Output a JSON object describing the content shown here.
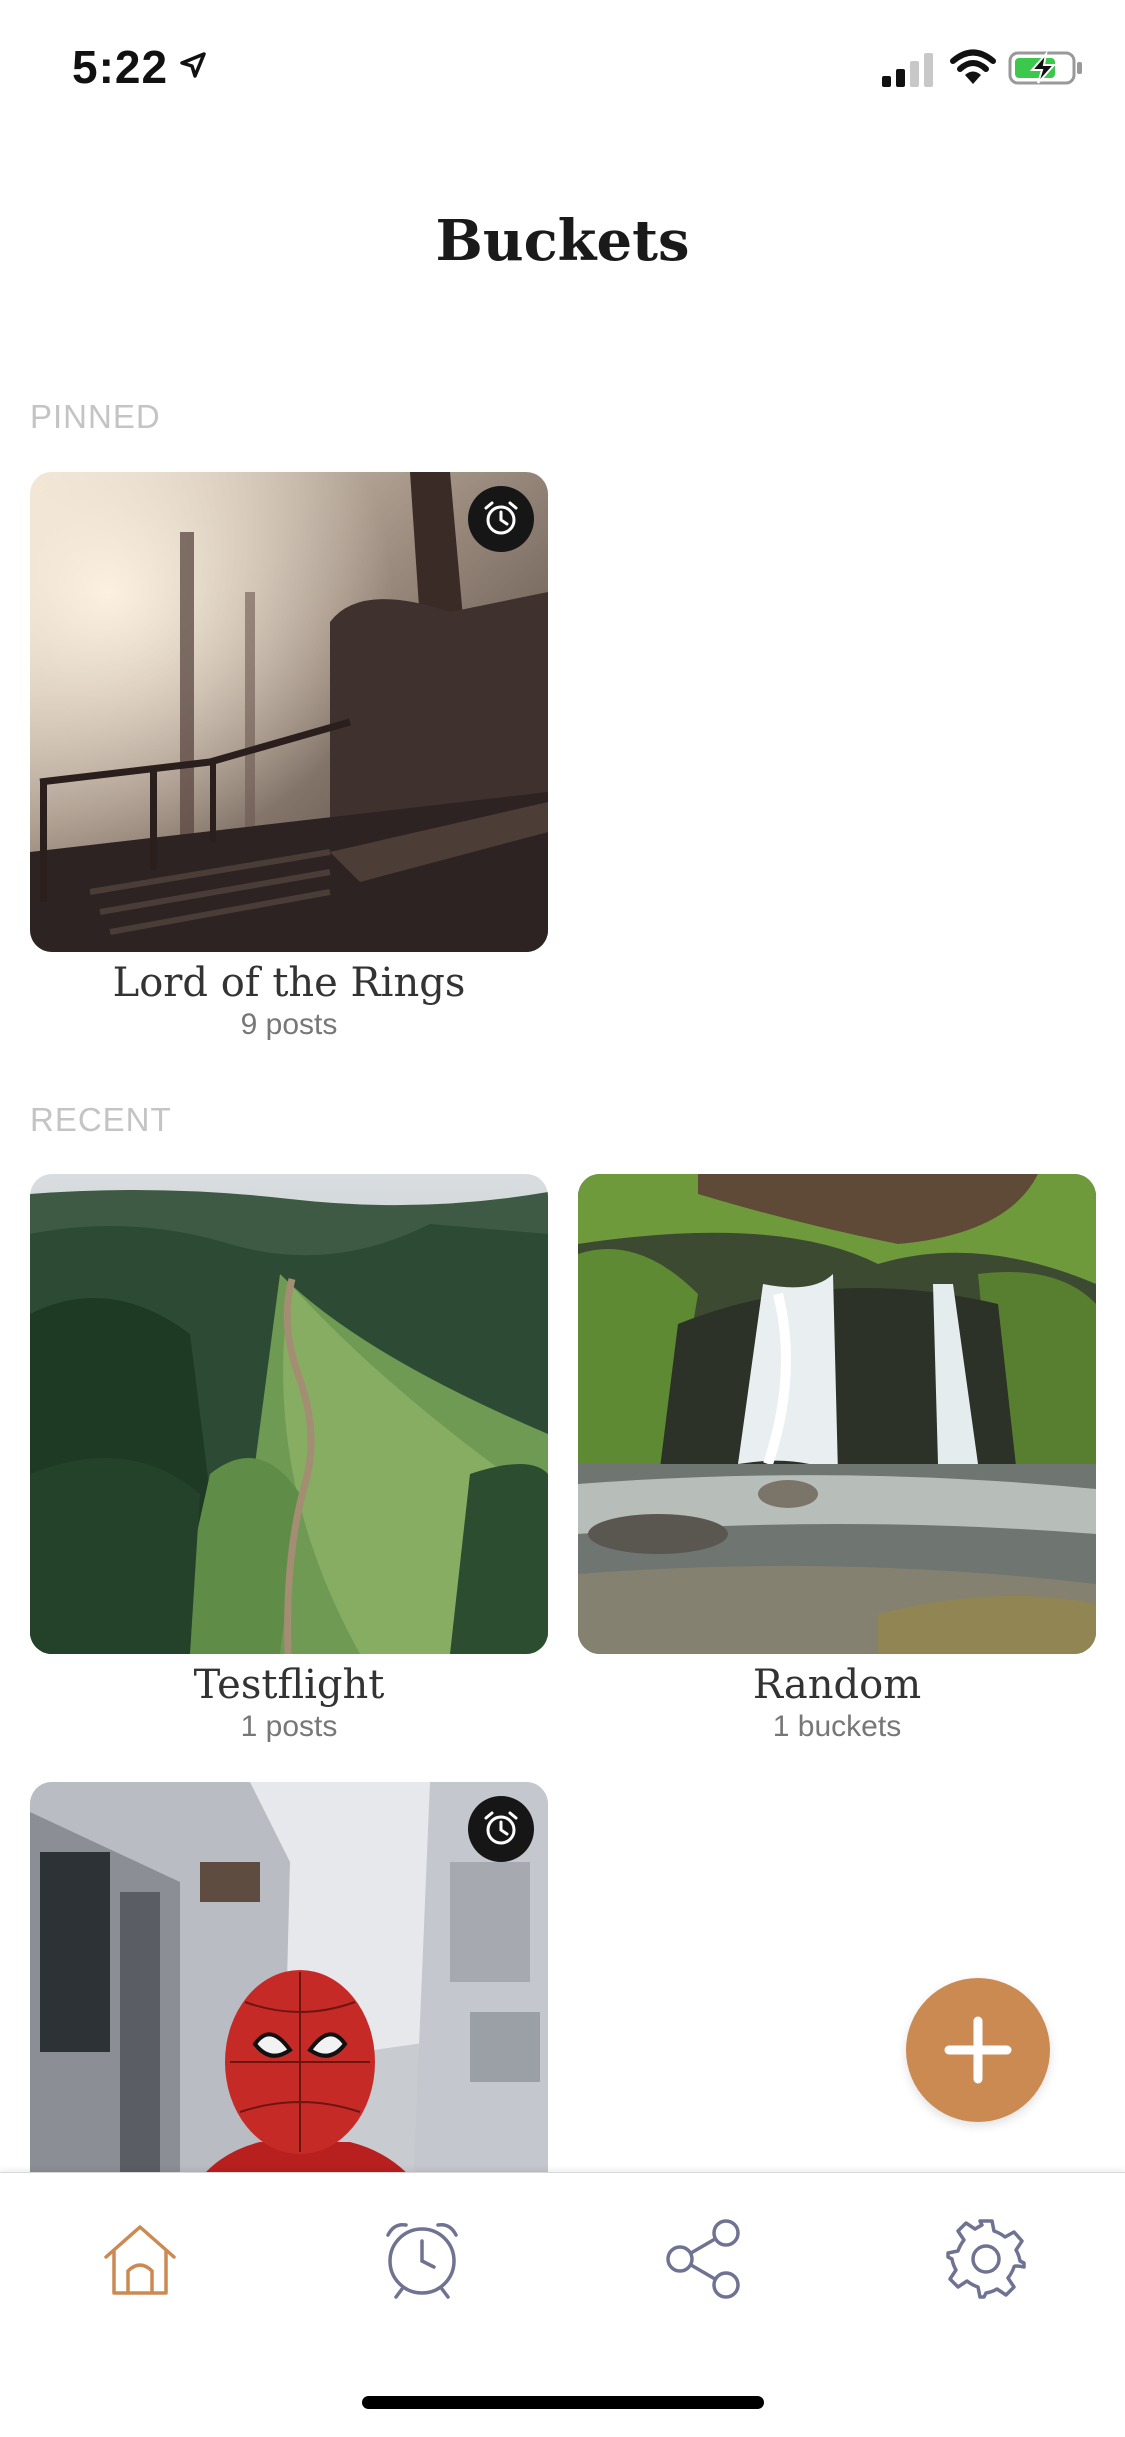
{
  "status_bar": {
    "time": "5:22"
  },
  "header": {
    "title": "Buckets"
  },
  "sections": {
    "pinned": {
      "label": "PINNED",
      "cards": [
        {
          "title": "Lord of the Rings",
          "subtitle": "9 posts",
          "image": "misty-forest-stairs",
          "has_alarm": true
        }
      ]
    },
    "recent": {
      "label": "RECENT",
      "cards": [
        {
          "title": "Testflight",
          "subtitle": "1 posts",
          "image": "green-ridge-trail",
          "has_alarm": false
        },
        {
          "title": "Random",
          "subtitle": "1 buckets",
          "image": "forest-waterfall",
          "has_alarm": false
        },
        {
          "title": "",
          "subtitle": "",
          "image": "spiderman-alley",
          "has_alarm": true
        }
      ]
    }
  },
  "fab": {
    "icon": "plus-icon"
  },
  "tab_bar": {
    "items": [
      {
        "icon": "home-icon",
        "active": true
      },
      {
        "icon": "clock-icon",
        "active": false
      },
      {
        "icon": "share-icon",
        "active": false
      },
      {
        "icon": "gear-icon",
        "active": false
      }
    ]
  },
  "colors": {
    "accent": "#cc8a53",
    "inactive_icon": "#6f7391",
    "section_label": "#c4c4c4"
  }
}
